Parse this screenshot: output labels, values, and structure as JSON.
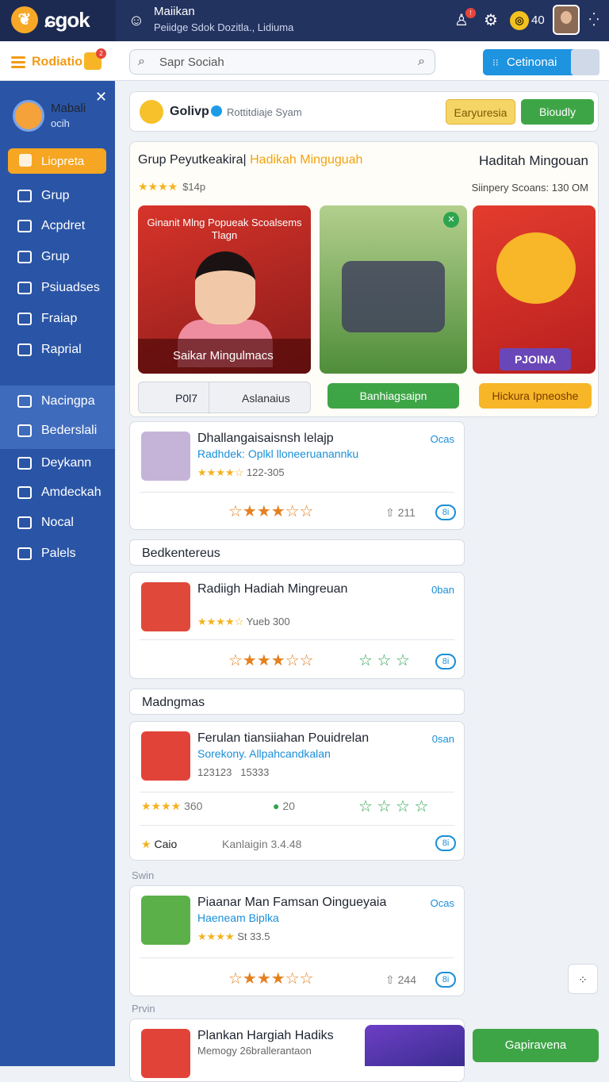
{
  "colors": {
    "sidebar": "#2a55a6",
    "topbar": "#23335f",
    "accent": "#f6a623",
    "green": "#3ea546",
    "blue": "#1e93e0"
  },
  "topbar": {
    "logo": "ɕgok",
    "user": "Maiikan",
    "subtitle": "Peiidge Sdok Dozitla., Lidiuma",
    "coins": "40",
    "icons": [
      "user-icon",
      "gear-icon",
      "coin-icon",
      "grid-icon"
    ]
  },
  "subbar": {
    "brand": "Rodiatio",
    "search_placeholder": "Sapr Sociah",
    "cta": "Cetinonai"
  },
  "sidebar": {
    "profile_name": "Mabali",
    "profile_sub": "ocih",
    "active": "Liopreta",
    "items": [
      "Grup",
      "Acpdret",
      "Grup",
      "Psiuadses",
      "Fraiap",
      "Raprial",
      "Nacingpa",
      "Bederslali",
      "Deykann",
      "Amdeckah",
      "Nocal",
      "Palels"
    ]
  },
  "header": {
    "title": "Golivp",
    "subtitle": "Rottitdiaje Syam",
    "btn1": "Earyuresia",
    "btn2": "Bioudly"
  },
  "feature": {
    "title": "Grup Peyutkeakira|",
    "title_hl": "Hadikah Minguguah",
    "right_title": "Haditah Mingouan",
    "rating": "$14p",
    "right_sub": "Siinpery Scoans: 130 OM",
    "img1_caption": "Ginanit Mlng Popueak Scoalsems Tlagn",
    "img1_label": "Saikar Mingulmacs",
    "img3_tag": "PJOINA",
    "pill1a": "P0l7",
    "pill1b": "Aslanaius",
    "pill2": "Banhiagsaipn",
    "pill3": "Hickura Ipneoshe"
  },
  "posts": [
    {
      "title": "Dhallangaisaisnsh lelajp",
      "sub": "Radhdek: Oplkl lloneeruanannku",
      "meta": "122-305",
      "tag": "Ocas",
      "count": "211",
      "btn": "8i"
    },
    {
      "title": "Radiigh Hadiah Mingreuan",
      "sub": "",
      "meta": "Yueb 300",
      "tag": "0ban",
      "count": "",
      "btn": "8i"
    },
    {
      "title": "Ferulan tiansiiahan Pouidrelan",
      "sub": "Sorekony. Allpahcandkalan",
      "meta": "123123",
      "meta2": "15333",
      "tag": "0san",
      "count": "360",
      "count2": "20",
      "footer_a": "Caio",
      "footer_b": "Kanlaigin 3.4.48",
      "btn": "8i"
    },
    {
      "title": "Piaanar Man Famsan Oingueyaia",
      "sub": "Haeneam Biplka",
      "meta": "St 33.5",
      "tag": "Ocas",
      "count": "244",
      "btn": "8i"
    },
    {
      "title": "Plankan Hargiah Hadiks",
      "sub": "Memogy 26brallerantaon",
      "meta": "",
      "tag": ""
    }
  ],
  "sections": {
    "s1": "Bedkentereus",
    "s2": "Madngmas",
    "l1": "Swin",
    "l2": "Prvin"
  },
  "bottom": {
    "button": "Gapiravena"
  }
}
